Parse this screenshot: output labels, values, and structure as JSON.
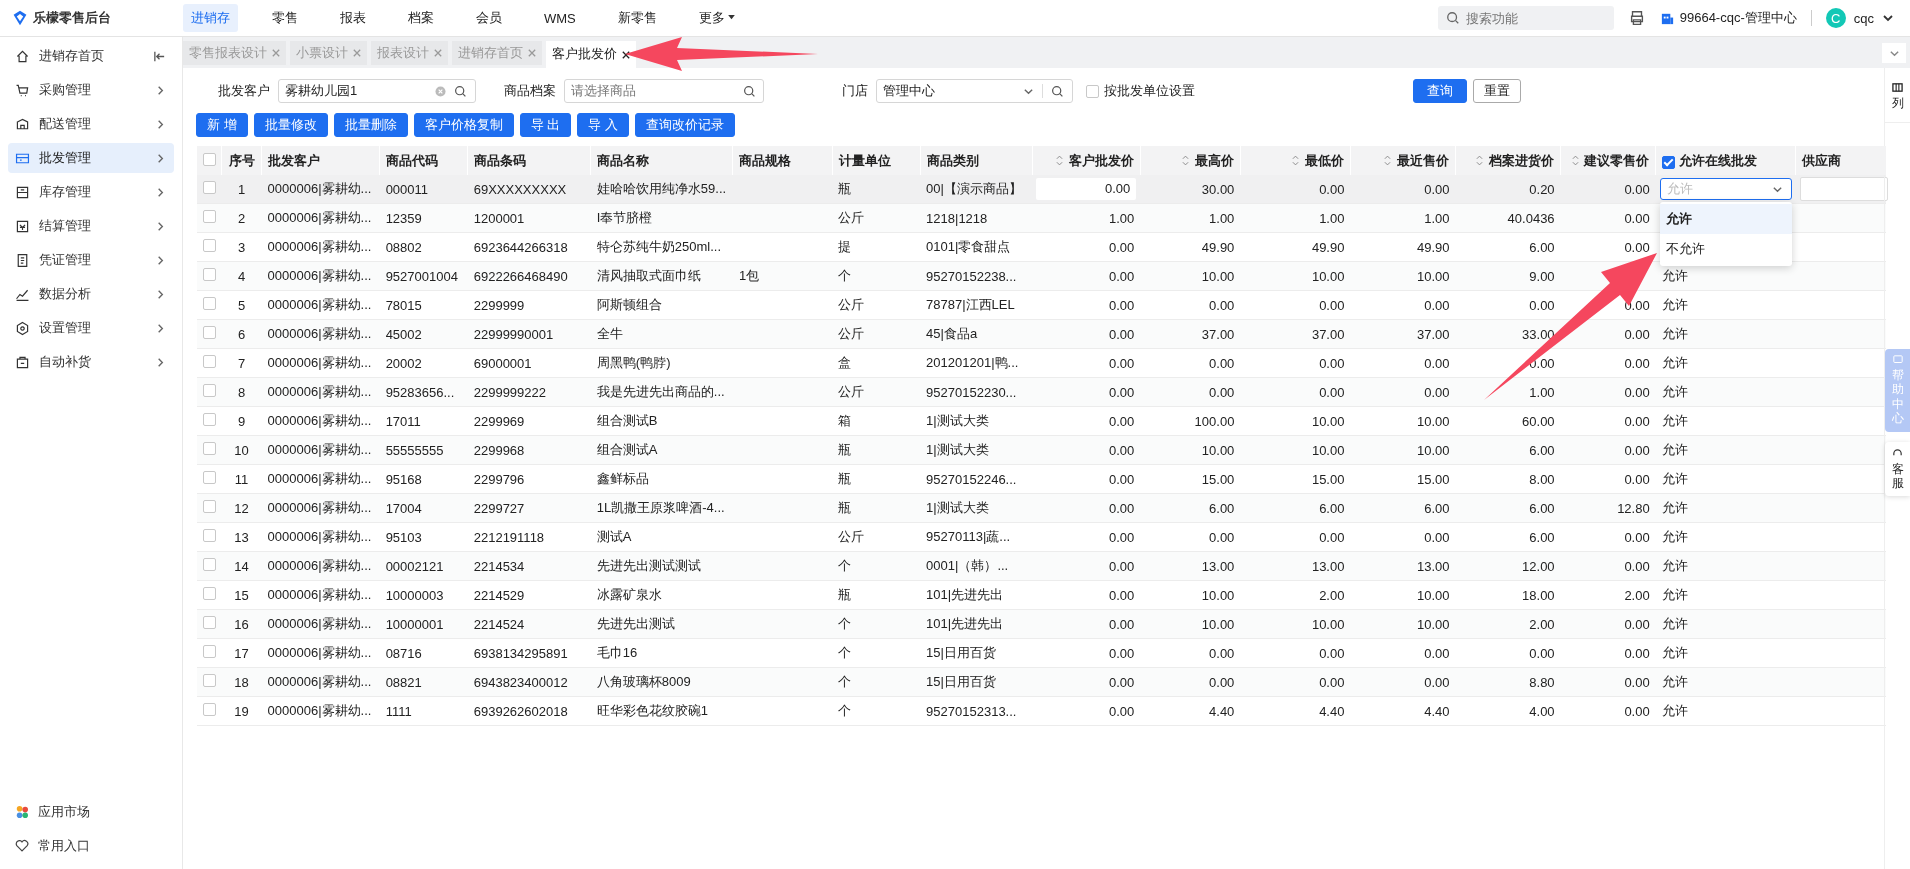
{
  "app": {
    "logo": "乐檬零售后台"
  },
  "top_nav": [
    {
      "label": "进销存",
      "selected": true
    },
    {
      "label": "零售",
      "selected": false
    },
    {
      "label": "报表",
      "selected": false
    },
    {
      "label": "档案",
      "selected": false
    },
    {
      "label": "会员",
      "selected": false
    },
    {
      "label": "WMS",
      "selected": false
    },
    {
      "label": "新零售",
      "selected": false
    },
    {
      "label": "更多",
      "selected": false,
      "kind": "menu"
    }
  ],
  "header_right": {
    "search_placeholder": "搜索功能",
    "store": "99664-cqc-管理中心",
    "avatar": "C",
    "user": "cqc"
  },
  "sidebar": {
    "items": [
      {
        "label": "进销存首页",
        "selected": false,
        "kind": "home"
      },
      {
        "label": "采购管理",
        "selected": false,
        "kind": "group"
      },
      {
        "label": "配送管理",
        "selected": false,
        "kind": "group"
      },
      {
        "label": "批发管理",
        "selected": true,
        "kind": "group"
      },
      {
        "label": "库存管理",
        "selected": false,
        "kind": "group"
      },
      {
        "label": "结算管理",
        "selected": false,
        "kind": "group"
      },
      {
        "label": "凭证管理",
        "selected": false,
        "kind": "group"
      },
      {
        "label": "数据分析",
        "selected": false,
        "kind": "group"
      },
      {
        "label": "设置管理",
        "selected": false,
        "kind": "group"
      },
      {
        "label": "自动补货",
        "selected": false,
        "kind": "group"
      }
    ],
    "bottom": [
      "应用市场",
      "常用入口"
    ]
  },
  "tabs": [
    {
      "label": "零售报表设计",
      "selected": false
    },
    {
      "label": "小票设计",
      "selected": false
    },
    {
      "label": "报表设计",
      "selected": false
    },
    {
      "label": "进销存首页",
      "selected": false
    },
    {
      "label": "客户批发价",
      "selected": true
    }
  ],
  "filters": {
    "customer_label": "批发客户",
    "customer_value": "雾耕幼儿园1",
    "product_label": "商品档案",
    "product_placeholder": "请选择商品",
    "store_label": "门店",
    "store_value": "管理中心",
    "by_unit_label": "按批发单位设置",
    "by_unit_checked": false,
    "query": "查询",
    "reset": "重置"
  },
  "actions": [
    "新 增",
    "批量修改",
    "批量删除",
    "客户价格复制",
    "导 出",
    "导 入",
    "查询改价记录"
  ],
  "table": {
    "all_checked": false,
    "columns": [
      {
        "label": "序号",
        "sortable": false
      },
      {
        "label": "批发客户",
        "sortable": false
      },
      {
        "label": "商品代码",
        "sortable": false
      },
      {
        "label": "商品条码",
        "sortable": false
      },
      {
        "label": "商品名称",
        "sortable": false
      },
      {
        "label": "商品规格",
        "sortable": false
      },
      {
        "label": "计量单位",
        "sortable": false
      },
      {
        "label": "商品类别",
        "sortable": false
      },
      {
        "label": "客户批发价",
        "sortable": true
      },
      {
        "label": "最高价",
        "sortable": true
      },
      {
        "label": "最低价",
        "sortable": true
      },
      {
        "label": "最近售价",
        "sortable": true
      },
      {
        "label": "档案进货价",
        "sortable": true
      },
      {
        "label": "建议零售价",
        "sortable": true
      },
      {
        "label": "允许在线批发",
        "sortable": false,
        "checked": true
      },
      {
        "label": "供应商",
        "sortable": false
      }
    ],
    "rows": [
      {
        "checked": false,
        "editing": true,
        "no": "1",
        "customer": "0000006|雾耕幼...",
        "code": "000011",
        "barcode": "69XXXXXXXXX",
        "name": "娃哈哈饮用纯净水59...",
        "unit": "瓶",
        "category": "00|【演示商品】",
        "price": "0.00",
        "max": "30.00",
        "min": "0.00",
        "recent": "0.00",
        "cost": "0.20",
        "retail": "0.00",
        "online_placeholder": "允许"
      },
      {
        "checked": false,
        "editing": false,
        "no": "2",
        "customer": "0000006|雾耕幼...",
        "code": "12359",
        "barcode": "1200001",
        "name": "I奉节脐橙",
        "unit": "公斤",
        "category": "1218|1218",
        "price": "1.00",
        "max": "1.00",
        "min": "1.00",
        "recent": "1.00",
        "cost": "40.0436",
        "retail": "0.00"
      },
      {
        "checked": false,
        "editing": false,
        "no": "3",
        "customer": "0000006|雾耕幼...",
        "code": "08802",
        "barcode": "6923644266318",
        "name": "特仑苏纯牛奶250ml...",
        "unit": "提",
        "category": "0101|零食甜点",
        "price": "0.00",
        "max": "49.90",
        "min": "49.90",
        "recent": "49.90",
        "cost": "6.00",
        "retail": "0.00"
      },
      {
        "checked": false,
        "editing": false,
        "no": "4",
        "customer": "0000006|雾耕幼...",
        "code": "9527001004",
        "barcode": "6922266468490",
        "name": "清风抽取式面巾纸",
        "spec": "1包",
        "unit": "个",
        "category": "95270152238...",
        "price": "0.00",
        "max": "10.00",
        "min": "10.00",
        "recent": "10.00",
        "cost": "9.00",
        "online": "允许"
      },
      {
        "checked": false,
        "editing": false,
        "no": "5",
        "customer": "0000006|雾耕幼...",
        "code": "78015",
        "barcode": "2299999",
        "name": "阿斯顿组合",
        "unit": "公斤",
        "category": "78787|江西LEL",
        "price": "0.00",
        "max": "0.00",
        "min": "0.00",
        "recent": "0.00",
        "cost": "0.00",
        "retail": "0.00",
        "online": "允许"
      },
      {
        "checked": false,
        "editing": false,
        "no": "6",
        "customer": "0000006|雾耕幼...",
        "code": "45002",
        "barcode": "22999990001",
        "name": "全牛",
        "unit": "公斤",
        "category": "45|食品a",
        "price": "0.00",
        "max": "37.00",
        "min": "37.00",
        "recent": "37.00",
        "cost": "33.00",
        "retail": "0.00",
        "online": "允许"
      },
      {
        "checked": false,
        "editing": false,
        "no": "7",
        "customer": "0000006|雾耕幼...",
        "code": "20002",
        "barcode": "69000001",
        "name": "周黑鸭(鸭脖)",
        "unit": "盒",
        "category": "201201201|鸭...",
        "price": "0.00",
        "max": "0.00",
        "min": "0.00",
        "recent": "0.00",
        "cost": "0.00",
        "retail": "0.00",
        "online": "允许"
      },
      {
        "checked": false,
        "editing": false,
        "no": "8",
        "customer": "0000006|雾耕幼...",
        "code": "95283656...",
        "barcode": "2299999222",
        "name": "我是先进先出商品的...",
        "unit": "公斤",
        "category": "95270152230...",
        "price": "0.00",
        "max": "0.00",
        "min": "0.00",
        "recent": "0.00",
        "cost": "1.00",
        "retail": "0.00",
        "online": "允许"
      },
      {
        "checked": false,
        "editing": false,
        "no": "9",
        "customer": "0000006|雾耕幼...",
        "code": "17011",
        "barcode": "2299969",
        "name": "组合测试B",
        "unit": "箱",
        "category": "1|测试大类",
        "price": "0.00",
        "max": "100.00",
        "min": "10.00",
        "recent": "10.00",
        "cost": "60.00",
        "retail": "0.00",
        "online": "允许"
      },
      {
        "checked": false,
        "editing": false,
        "no": "10",
        "customer": "0000006|雾耕幼...",
        "code": "55555555",
        "barcode": "2299968",
        "name": "组合测试A",
        "unit": "瓶",
        "category": "1|测试大类",
        "price": "0.00",
        "max": "10.00",
        "min": "10.00",
        "recent": "10.00",
        "cost": "6.00",
        "retail": "0.00",
        "online": "允许"
      },
      {
        "checked": false,
        "editing": false,
        "no": "11",
        "customer": "0000006|雾耕幼...",
        "code": "95168",
        "barcode": "2299796",
        "name": "鑫鲜标品",
        "unit": "瓶",
        "category": "95270152246...",
        "price": "0.00",
        "max": "15.00",
        "min": "15.00",
        "recent": "15.00",
        "cost": "8.00",
        "retail": "0.00",
        "online": "允许"
      },
      {
        "checked": false,
        "editing": false,
        "no": "12",
        "customer": "0000006|雾耕幼...",
        "code": "17004",
        "barcode": "2299727",
        "name": "1L凯撒王原浆啤酒-4...",
        "unit": "瓶",
        "category": "1|测试大类",
        "price": "0.00",
        "max": "6.00",
        "min": "6.00",
        "recent": "6.00",
        "cost": "6.00",
        "retail": "12.80",
        "online": "允许"
      },
      {
        "checked": false,
        "editing": false,
        "no": "13",
        "customer": "0000006|雾耕幼...",
        "code": "95103",
        "barcode": "2212191118",
        "name": "测试A",
        "unit": "公斤",
        "category": "95270113|蔬...",
        "price": "0.00",
        "max": "0.00",
        "min": "0.00",
        "recent": "0.00",
        "cost": "6.00",
        "retail": "0.00",
        "online": "允许"
      },
      {
        "checked": false,
        "editing": false,
        "no": "14",
        "customer": "0000006|雾耕幼...",
        "code": "00002121",
        "barcode": "2214534",
        "name": "先进先出测试测试",
        "unit": "个",
        "category": "0001|（韩）...",
        "price": "0.00",
        "max": "13.00",
        "min": "13.00",
        "recent": "13.00",
        "cost": "12.00",
        "retail": "0.00",
        "online": "允许"
      },
      {
        "checked": false,
        "editing": false,
        "no": "15",
        "customer": "0000006|雾耕幼...",
        "code": "10000003",
        "barcode": "2214529",
        "name": "冰露矿泉水",
        "unit": "瓶",
        "category": "101|先进先出",
        "price": "0.00",
        "max": "10.00",
        "min": "2.00",
        "recent": "10.00",
        "cost": "18.00",
        "retail": "2.00",
        "online": "允许"
      },
      {
        "checked": false,
        "editing": false,
        "no": "16",
        "customer": "0000006|雾耕幼...",
        "code": "10000001",
        "barcode": "2214524",
        "name": "先进先出测试",
        "unit": "个",
        "category": "101|先进先出",
        "price": "0.00",
        "max": "10.00",
        "min": "10.00",
        "recent": "10.00",
        "cost": "2.00",
        "retail": "0.00",
        "online": "允许"
      },
      {
        "checked": false,
        "editing": false,
        "no": "17",
        "customer": "0000006|雾耕幼...",
        "code": "08716",
        "barcode": "6938134295891",
        "name": "毛巾16",
        "unit": "个",
        "category": "15|日用百货",
        "price": "0.00",
        "max": "0.00",
        "min": "0.00",
        "recent": "0.00",
        "cost": "0.00",
        "retail": "0.00",
        "online": "允许"
      },
      {
        "checked": false,
        "editing": false,
        "no": "18",
        "customer": "0000006|雾耕幼...",
        "code": "08821",
        "barcode": "6943823400012",
        "name": "八角玻璃杯8009",
        "unit": "个",
        "category": "15|日用百货",
        "price": "0.00",
        "max": "0.00",
        "min": "0.00",
        "recent": "0.00",
        "cost": "8.80",
        "retail": "0.00",
        "online": "允许"
      },
      {
        "checked": false,
        "editing": false,
        "no": "19",
        "customer": "0000006|雾耕幼...",
        "code": "1111",
        "barcode": "6939262602018",
        "name": "旺华彩色花纹胶碗1",
        "unit": "个",
        "category": "95270152313...",
        "price": "0.00",
        "max": "4.40",
        "min": "4.40",
        "recent": "4.40",
        "cost": "4.00",
        "retail": "0.00",
        "online": "允许"
      }
    ],
    "dropdown": {
      "options": [
        {
          "label": "允许",
          "selected": true
        },
        {
          "label": "不允许",
          "selected": false
        }
      ]
    }
  },
  "right_rail": {
    "columns": "列",
    "help": "帮助中心",
    "service": "客服"
  }
}
